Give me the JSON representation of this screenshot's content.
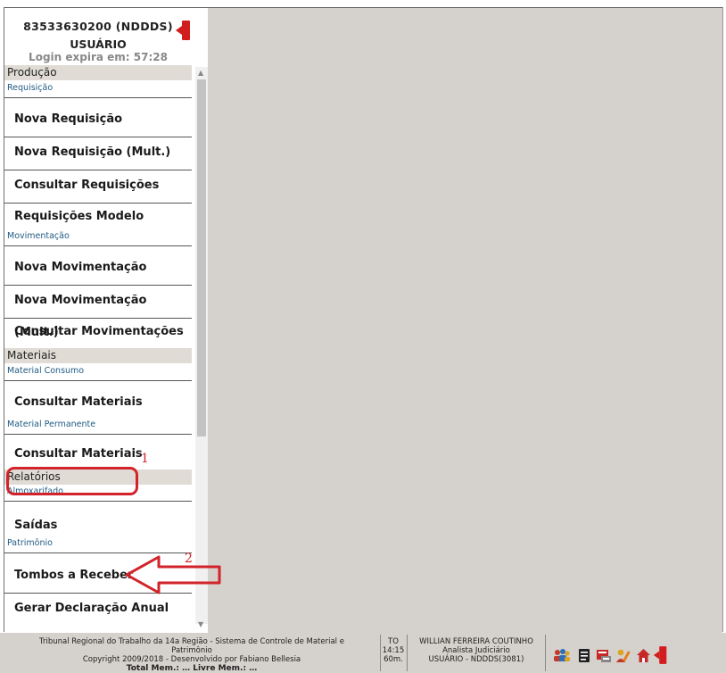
{
  "header": {
    "login_code": "83533630200  (NDDDS)",
    "user_label": "USUÁRIO",
    "expiry_text": "Login expira em: 57:28"
  },
  "sidebar": {
    "categories": {
      "producao": "Produção",
      "materiais": "Materiais",
      "relatorios": "Relatórios"
    },
    "subsections": {
      "requisicao": "Requisição",
      "movimentacao": "Movimentação",
      "material_consumo": "Material Consumo",
      "material_permanente": "Material Permanente",
      "almoxarifado": "Almoxarifado",
      "patrimonio": "Patrimônio"
    },
    "items": {
      "nova_requisicao": "Nova Requisição",
      "nova_requisicao_mult": "Nova Requisição (Mult.)",
      "consultar_requisicoes": "Consultar Requisições",
      "requisicoes_modelo": "Requisições Modelo",
      "nova_movimentacao": "Nova Movimentação",
      "nova_movimentacao_mult": "Nova Movimentação (Mult.)",
      "consultar_movimentacoes": "Consultar Movimentações",
      "consultar_materiais_consumo": "Consultar Materiais",
      "consultar_materiais_permanente": "Consultar Materiais",
      "saidas": "Saídas",
      "tombos_a_receber": "Tombos a Receber",
      "gerar_declaracao_anual": "Gerar Declaração Anual"
    }
  },
  "annotations": {
    "marker_1": "1",
    "marker_2": "2",
    "color": "#d2232a"
  },
  "footer": {
    "system_line1": "Tribunal Regional do Trabalho da 14a Região - Sistema de Controle de Material e",
    "system_line2": "Patrimônio",
    "system_line3": "Copyright 2009/2018 - Desenvolvido por Fabiano Bellesia",
    "system_line4": "Total Mem.: …  Livre Mem.: …",
    "to_label": "TO",
    "time": "14:15",
    "duration": "60m.",
    "user_name": "WILLIAN FERREIRA COUTINHO",
    "user_role": "Analista Judiciário",
    "user_unit": "USUÁRIO - NDDDS(3081)",
    "icons": [
      "users-icon",
      "document-icon",
      "form-icon",
      "person-pencil-icon",
      "home-icon",
      "exit-icon"
    ]
  },
  "colors": {
    "background_pane": "#d5d1cc",
    "category_bg": "#e0dcd5",
    "subsection_text": "#1f5a84",
    "exit_red": "#d11d1d"
  }
}
